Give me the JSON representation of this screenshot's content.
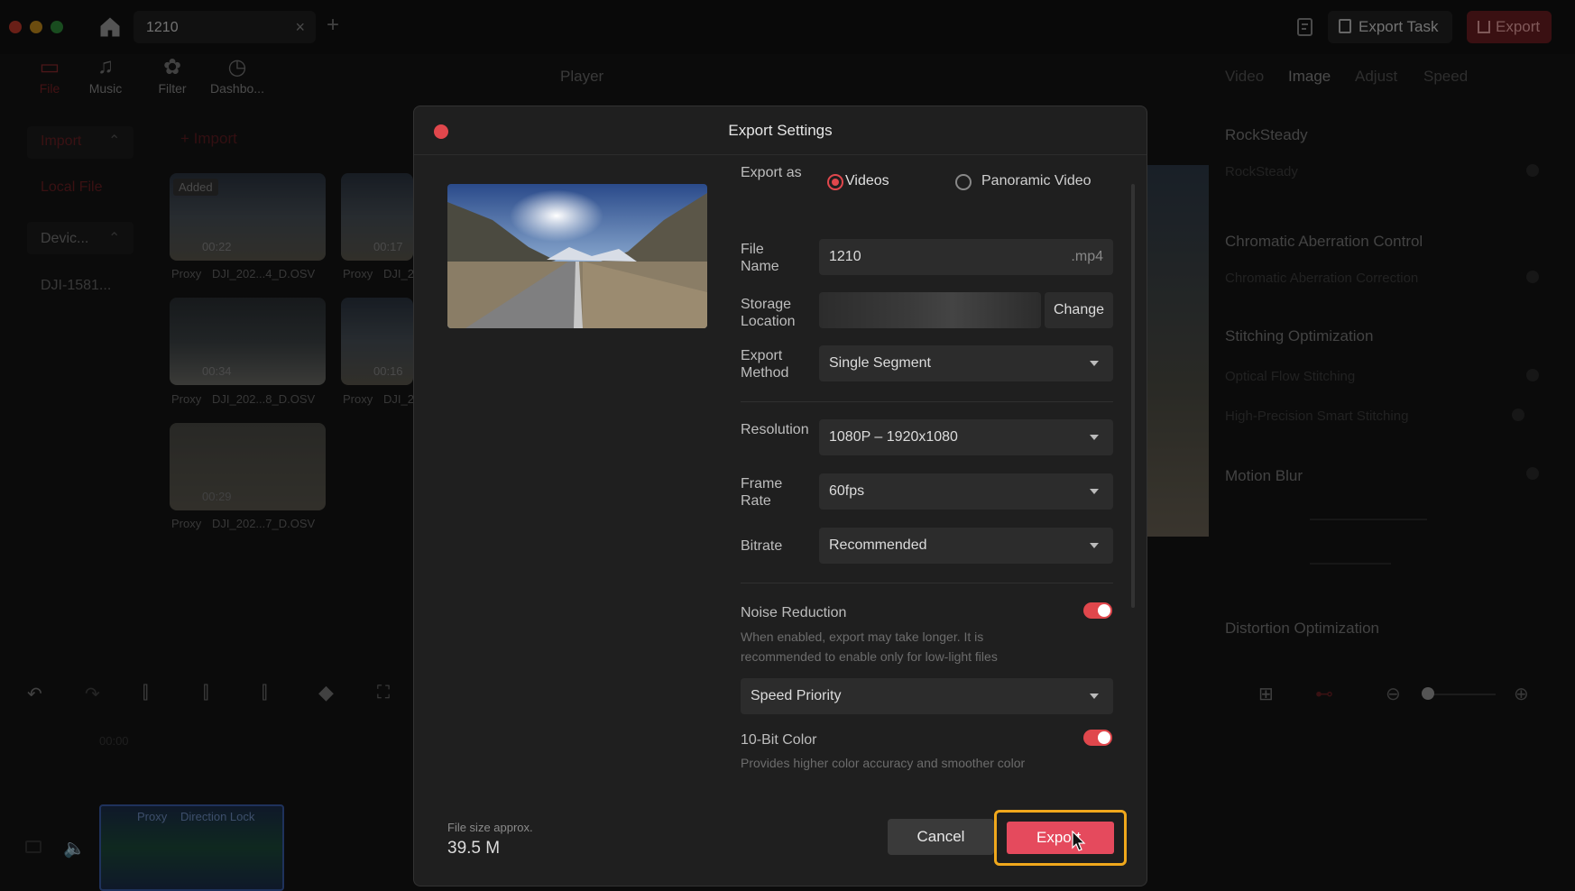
{
  "titlebar": {
    "project_tab": "1210",
    "close_glyph": "×",
    "add_glyph": "+",
    "export_task_label": "Export Task",
    "export_label": "Export"
  },
  "toolbar": {
    "items": [
      {
        "label": "File",
        "icon": "folder-icon"
      },
      {
        "label": "Music",
        "icon": "music-icon"
      },
      {
        "label": "Filter",
        "icon": "filter-icon"
      },
      {
        "label": "Dashbo...",
        "icon": "dashboard-icon"
      }
    ]
  },
  "sidebar": {
    "import": "Import",
    "local_file": "Local File",
    "device": "Devic...",
    "device_item": "DJI-1581..."
  },
  "media": {
    "import_button": "Import",
    "added_badge": "Added",
    "clips": [
      {
        "duration": "00:22",
        "name": "DJI_202...4_D.OSV",
        "proxy": "Proxy"
      },
      {
        "duration": "00:17",
        "name": "DJI_2",
        "proxy": "Proxy"
      },
      {
        "duration": "00:34",
        "name": "DJI_202...8_D.OSV",
        "proxy": "Proxy"
      },
      {
        "duration": "00:16",
        "name": "DJI_2",
        "proxy": "Proxy"
      },
      {
        "duration": "00:29",
        "name": "DJI_202...7_D.OSV",
        "proxy": "Proxy"
      }
    ]
  },
  "player": {
    "title": "Player"
  },
  "right_panel": {
    "tabs": [
      "Video",
      "Image",
      "Adjust",
      "Speed"
    ],
    "rocksteady_header": "RockSteady",
    "rocksteady_item": "RockSteady",
    "chromatic_header": "Chromatic Aberration Control",
    "chromatic_item": "Chromatic Aberration Correction",
    "stitching_header": "Stitching Optimization",
    "optical_flow": "Optical Flow Stitching",
    "high_precision": "High-Precision Smart Stitching",
    "motion_blur": "Motion Blur",
    "distortion": "Distortion Optimization"
  },
  "timeline": {
    "time": "00:00",
    "clip_proxy": "Proxy",
    "clip_direction": "Direction Lock"
  },
  "modal": {
    "title": "Export Settings",
    "export_as_label": "Export as",
    "export_as_options": [
      "Videos",
      "Panoramic Video"
    ],
    "export_as_selected": "Videos",
    "file_name_label": "File Name",
    "file_name_value": "1210",
    "file_ext": ".mp4",
    "storage_label": "Storage Location",
    "change_button": "Change",
    "export_method_label": "Export Method",
    "export_method_value": "Single Segment",
    "resolution_label": "Resolution",
    "resolution_value": "1080P – 1920x1080",
    "frame_rate_label": "Frame Rate",
    "frame_rate_value": "60fps",
    "bitrate_label": "Bitrate",
    "bitrate_value": "Recommended",
    "noise_reduction_label": "Noise Reduction",
    "noise_reduction_on": true,
    "noise_reduction_hint": "When enabled, export may take longer. It is recommended to enable only for low-light files",
    "priority_value": "Speed Priority",
    "tenbit_label": "10-Bit Color",
    "tenbit_on": true,
    "tenbit_hint": "Provides higher color accuracy and smoother color",
    "file_size_label": "File size approx.",
    "file_size_value": "39.5 M",
    "cancel_button": "Cancel",
    "export_button": "Export"
  },
  "colors": {
    "accent": "#e0474c",
    "export_button": "#e54a5d",
    "highlight_border": "#f0a81c",
    "modal_bg": "#1f1f1f"
  }
}
